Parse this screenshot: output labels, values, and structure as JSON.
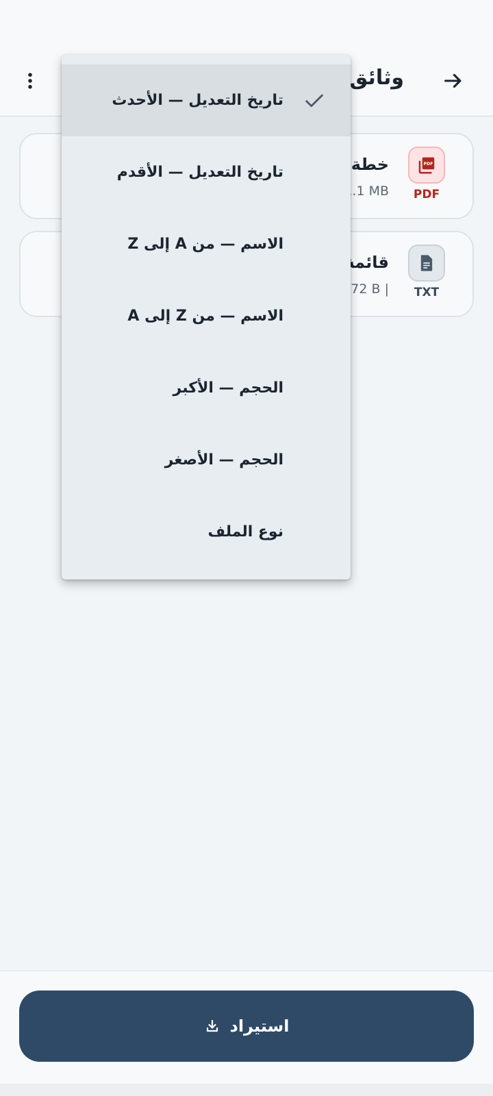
{
  "header": {
    "title": "وثائق",
    "back_icon": "arrow-forward-icon",
    "more_icon": "more-vert-icon"
  },
  "files": [
    {
      "name": "خطة",
      "meta": "1.1 MB",
      "type": "PDF",
      "icon": "pdf-icon",
      "color": "#b3261e"
    },
    {
      "name": "قائمة",
      "meta": "72 B |",
      "type": "TXT",
      "icon": "description-icon",
      "color": "#3c4a56"
    }
  ],
  "sort_menu": {
    "selected_index": 0,
    "check_icon": "check-icon",
    "items": [
      {
        "label": "تاريخ التعديل — الأحدث"
      },
      {
        "label": "تاريخ التعديل — الأقدم"
      },
      {
        "label": "الاسم — من A إلى Z"
      },
      {
        "label": "الاسم — من Z إلى A"
      },
      {
        "label": "الحجم — الأكبر"
      },
      {
        "label": "الحجم — الأصغر"
      },
      {
        "label": "نوع الملف"
      }
    ]
  },
  "bottom": {
    "import_label": "استيراد",
    "import_icon": "download-icon",
    "button_color": "#2e4a66"
  }
}
